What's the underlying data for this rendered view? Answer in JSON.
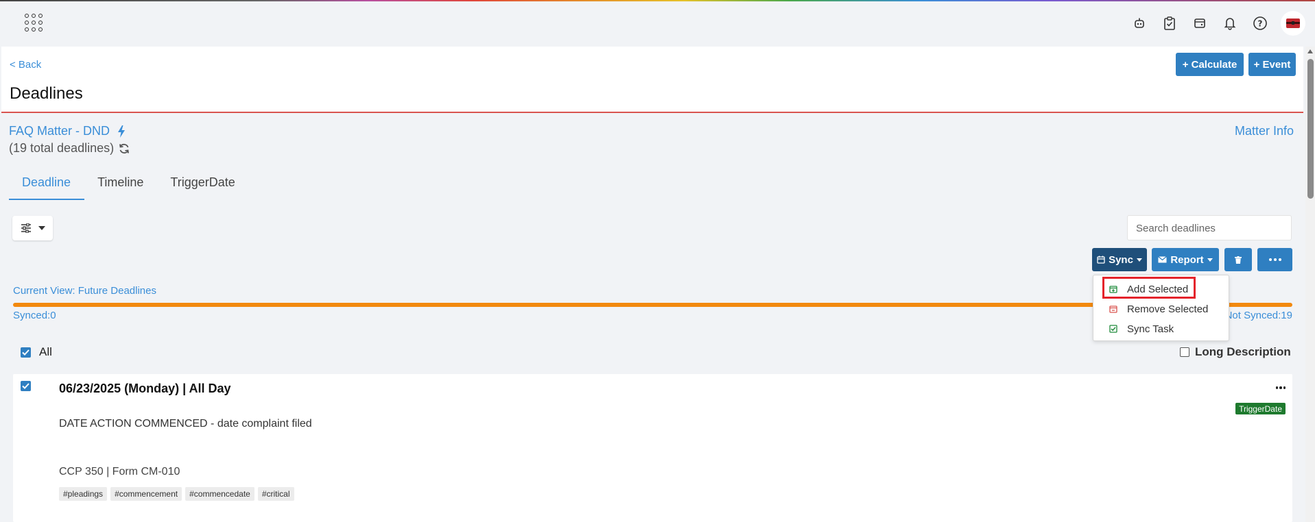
{
  "header": {
    "back_label": "< Back",
    "title": "Deadlines",
    "calculate_label": "+ Calculate",
    "event_label": "+ Event"
  },
  "topbar": {
    "icons": [
      "apps-icon",
      "robot-icon",
      "clipboard-check-icon",
      "wallet-icon",
      "bell-icon",
      "help-icon",
      "avatar"
    ]
  },
  "matter": {
    "title": "FAQ Matter - DND",
    "count": "(19 total deadlines)",
    "info_label": "Matter Info"
  },
  "tabs": [
    {
      "label": "Deadline",
      "active": true
    },
    {
      "label": "Timeline",
      "active": false
    },
    {
      "label": "TriggerDate",
      "active": false
    }
  ],
  "toolbar": {
    "search_placeholder": "Search deadlines",
    "sync_label": "Sync",
    "report_label": "Report"
  },
  "sync_menu": {
    "items": [
      {
        "label": "Add Selected",
        "icon": "calendar-plus-icon",
        "color": "#1e8a3a"
      },
      {
        "label": "Remove Selected",
        "icon": "calendar-minus-icon",
        "color": "#d9534f"
      },
      {
        "label": "Sync Task",
        "icon": "check-square-icon",
        "color": "#1e8a3a"
      }
    ]
  },
  "view": {
    "current": "Current View: Future Deadlines",
    "synced": "Synced:0",
    "not_synced": "Not Synced:19",
    "sync_progress": 1.0
  },
  "list": {
    "all_label": "All",
    "long_description_label": "Long Description"
  },
  "deadlines": [
    {
      "date": "06/23/2025 (Monday) | All Day",
      "badge": "TriggerDate",
      "action": "DATE ACTION COMMENCED - date complaint filed",
      "rule": "CCP 350 | Form CM-010",
      "tags": [
        "#pleadings",
        "#commencement",
        "#commencedate",
        "#critical"
      ],
      "checked": true
    }
  ],
  "colors": {
    "primary": "#2f7fc1",
    "sync_button": "#1f4f7a",
    "link": "#3a8ed8",
    "progress": "#f2890f",
    "header_border": "#d9534f",
    "badge": "#1e7a2e",
    "highlight": "#e4232b"
  }
}
